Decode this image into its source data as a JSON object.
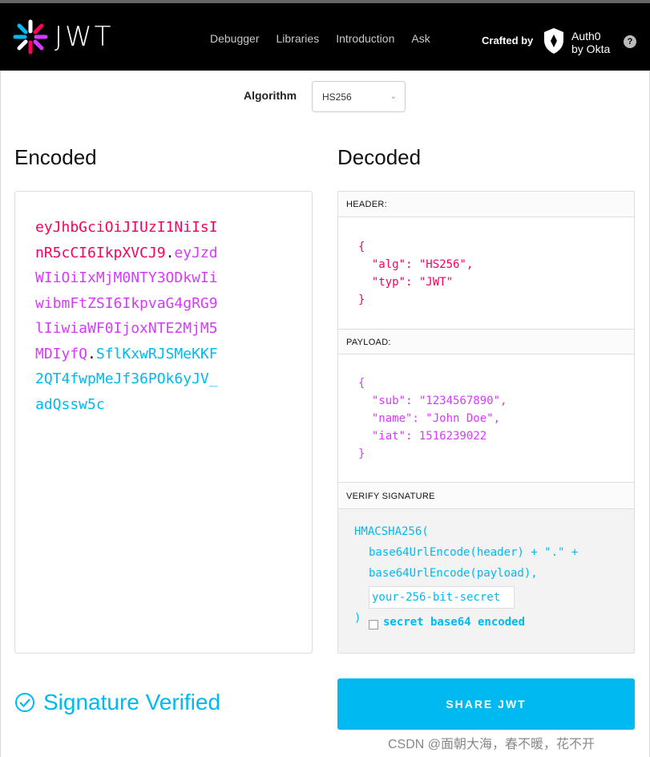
{
  "brand": {
    "logo_text": "JWT"
  },
  "nav": {
    "items": [
      "Debugger",
      "Libraries",
      "Introduction",
      "Ask"
    ]
  },
  "crafted": {
    "label": "Crafted by",
    "auth0_line1": "Auth0",
    "auth0_line2": "by Okta"
  },
  "help": {
    "label": "?"
  },
  "algorithm": {
    "label": "Algorithm",
    "selected": "HS256"
  },
  "encoded": {
    "title": "Encoded",
    "lines": [
      {
        "text": "eyJhbGciOiJIUzI1NiIsI",
        "parts": []
      },
      {
        "a": "nR5cCI6IkpXVCJ9",
        "dot": ".",
        "b": "eyJzd"
      },
      {
        "text": "WIiOiIxMjM0NTY3ODkwIi"
      },
      {
        "text": "wibmFtZSI6IkpvaG4gRG9"
      },
      {
        "text": "lIiwiaWF0IjoxNTE2MjM5"
      },
      {
        "a": "MDIyfQ",
        "dot": ".",
        "b": "SflKxwRJSMeKKF"
      },
      {
        "text": "2QT4fwpMeJf36POk6yJV_"
      },
      {
        "text": "adQssw5c"
      }
    ]
  },
  "decoded": {
    "title": "Decoded",
    "header_label": "HEADER:",
    "header_json": "{\n  \"alg\": \"HS256\",\n  \"typ\": \"JWT\"\n}",
    "payload_label": "PAYLOAD:",
    "payload_json": "{\n  \"sub\": \"1234567890\",\n  \"name\": \"John Doe\",\n  \"iat\": 1516239022\n}",
    "verify_label": "VERIFY SIGNATURE",
    "sig_line1": "HMACSHA256(",
    "sig_line2": "base64UrlEncode(header) + \".\" +",
    "sig_line3": "base64UrlEncode(payload),",
    "secret_placeholder": "your-256-bit-secret",
    "sig_close": ")",
    "b64_label": "secret base64 encoded"
  },
  "status": {
    "text": "Signature Verified"
  },
  "share": {
    "label": "SHARE JWT"
  },
  "watermark": {
    "text": "CSDN @面朝大海，春不暖，花不开"
  },
  "colors": {
    "header": "#fb015b",
    "payload": "#d63aff",
    "signature": "#00b9f1"
  }
}
